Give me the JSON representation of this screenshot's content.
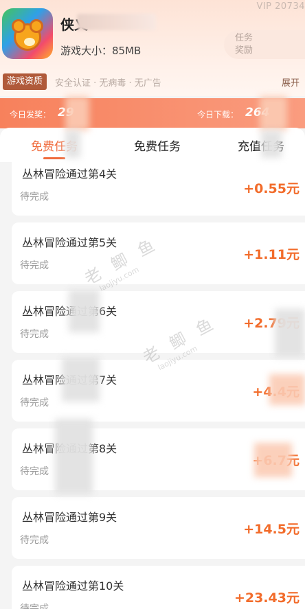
{
  "header": {
    "vip_text": "VIP 20734",
    "app_name": "侠义",
    "app_size": "游戏大小：85MB",
    "task_reward_line1": "任务",
    "task_reward_line2": "奖励",
    "tag_label": "游戏资质",
    "tag_text": "安全认证 · 无病毒 · 无广告",
    "expand_label": "展开"
  },
  "stats": {
    "today_reward_label": "今日发奖：",
    "today_reward_value": "29",
    "today_download_label": "今日下载：",
    "today_download_value": "264"
  },
  "tabs": [
    {
      "label": "免费任务"
    },
    {
      "label": "免费任务"
    },
    {
      "label": "充值任务"
    }
  ],
  "tasks": [
    {
      "title": "丛林冒险通过第4关",
      "status": "待完成",
      "reward": "+0.55元"
    },
    {
      "title": "丛林冒险通过第5关",
      "status": "待完成",
      "reward": "+1.11元"
    },
    {
      "title": "丛林冒险通过第6关",
      "status": "待完成",
      "reward": "+2.79元"
    },
    {
      "title": "丛林冒险通过第7关",
      "status": "待完成",
      "reward": "+4.4元"
    },
    {
      "title": "丛林冒险通过第8关",
      "status": "待完成",
      "reward": "+6.7元"
    },
    {
      "title": "丛林冒险通过第9关",
      "status": "待完成",
      "reward": "+14.5元"
    },
    {
      "title": "丛林冒险通过第10关",
      "status": "待完成",
      "reward": "+23.43元"
    }
  ],
  "watermarks": [
    {
      "big": "老 鲫 鱼",
      "small": "laojiyu.com"
    },
    {
      "big": "老 鲫 鱼",
      "small": "laojiyu.com"
    }
  ],
  "colors": {
    "accent": "#f06b3c",
    "reward": "#f26c2b",
    "stats_bar": "#f7815c",
    "tag_badge": "#b05a3a"
  }
}
